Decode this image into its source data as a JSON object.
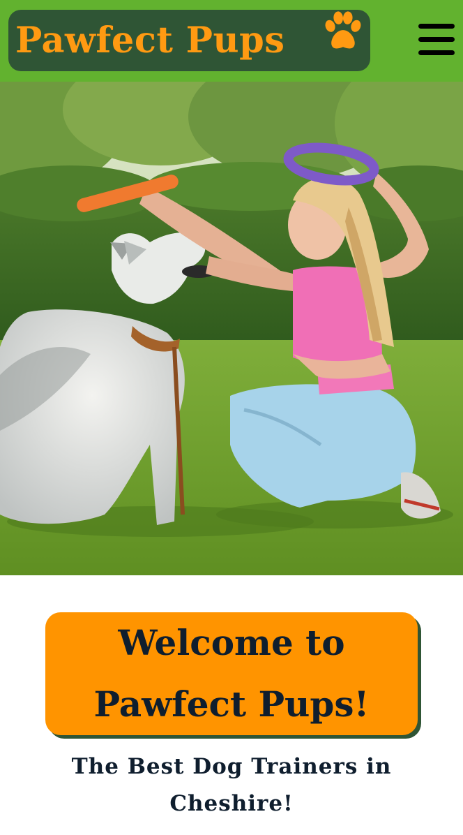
{
  "header": {
    "brand": "Pawfect Pups",
    "paw_icon": "paw-icon",
    "menu_icon": "hamburger-menu-icon",
    "brand_color": "#ff9a12",
    "bar_color": "#62b22f",
    "logo_bg": "#2f5535"
  },
  "hero": {
    "image": "woman-training-husky-photo"
  },
  "main": {
    "welcome_label": "Welcome to Pawfect Pups!",
    "tagline": "The Best Dog Trainers in Cheshire!",
    "button_color": "#ff9400"
  }
}
